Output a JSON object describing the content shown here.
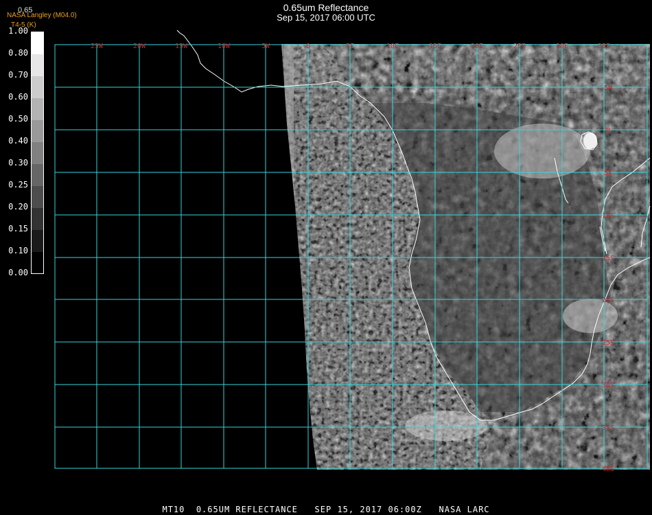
{
  "header": {
    "title": "0.65um Reflectance",
    "subtitle": "Sep 15, 2017 06:00 UTC",
    "provider": "NASA Langley (M04.0)",
    "secondary_label": "T4-5 (K)",
    "stub_label": "0.65"
  },
  "colorbar": {
    "labels": [
      "1.00",
      "0.80",
      "0.70",
      "0.60",
      "0.50",
      "0.40",
      "0.30",
      "0.25",
      "0.20",
      "0.15",
      "0.10",
      "0.00"
    ]
  },
  "map": {
    "longitude_labels": [
      "25W",
      "20W",
      "15W",
      "10W",
      "5W",
      "0",
      "5E",
      "10E",
      "15E",
      "20E",
      "25E",
      "30E",
      "35E"
    ],
    "latitude_labels": [
      "5N",
      "0",
      "5S",
      "10S",
      "15S",
      "20S",
      "25S",
      "30S",
      "35S",
      "40S"
    ],
    "grid_color": "#33d6dd",
    "label_color": "#c8282a",
    "coastline_color": "#ffffff"
  },
  "footer": {
    "text": "MT10  0.65UM REFLECTANCE   SEP 15, 2017 06:00Z   NASA LARC"
  }
}
